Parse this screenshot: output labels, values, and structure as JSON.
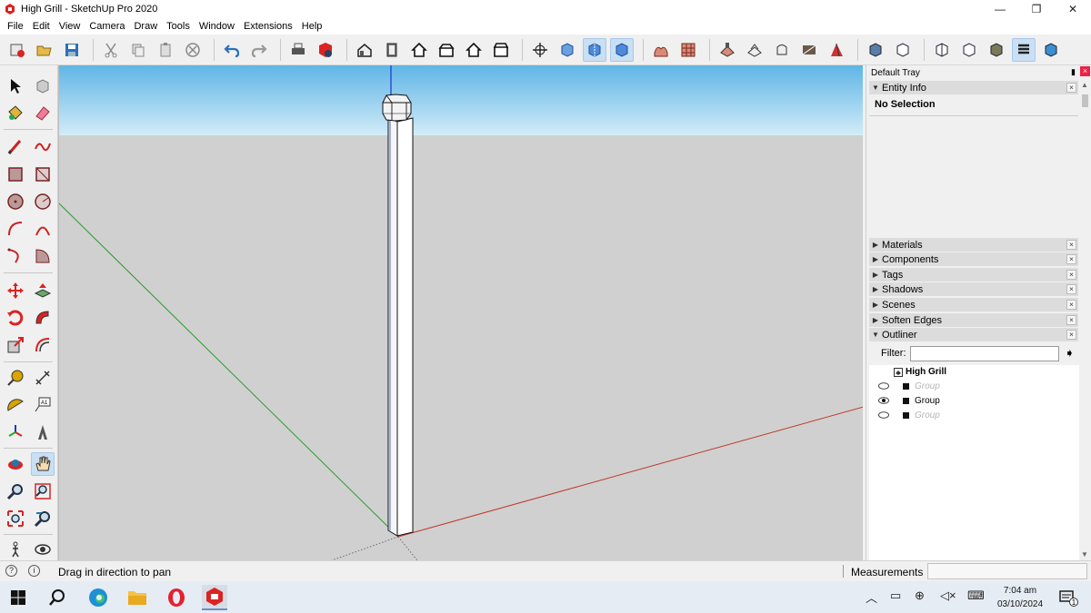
{
  "window": {
    "title": "High Grill - SketchUp Pro 2020",
    "minimize": "—",
    "restore": "❐",
    "close": "✕"
  },
  "menu": [
    "File",
    "Edit",
    "View",
    "Camera",
    "Draw",
    "Tools",
    "Window",
    "Extensions",
    "Help"
  ],
  "tray": {
    "title": "Default Tray",
    "pin": "▮",
    "close": "×",
    "entity_info": {
      "label": "Entity Info",
      "status": "No Selection"
    },
    "panels": [
      "Materials",
      "Components",
      "Tags",
      "Shadows",
      "Scenes",
      "Soften Edges",
      "Outliner"
    ],
    "panel_close": "×",
    "outliner": {
      "filter_label": "Filter:",
      "filter_value": "",
      "model_name": "High Grill",
      "rows": [
        {
          "label": "Group",
          "visible": false
        },
        {
          "label": "Group",
          "visible": true
        },
        {
          "label": "Group",
          "visible": false
        }
      ]
    }
  },
  "status": {
    "hint": "Drag in direction to pan",
    "measurements_label": "Measurements",
    "measurements_value": ""
  },
  "taskbar": {
    "time": "7:04 am",
    "date": "03/10/2024",
    "notification_count": "1"
  },
  "colors": {
    "sky_top": "#5fb5e6",
    "sky_bottom": "#cfe9f7",
    "ground": "#d2d2d2",
    "axis_red": "#c0392b",
    "axis_green": "#2e9a2e",
    "axis_blue": "#1f3fd0",
    "active_tool": "#c9dff3"
  },
  "icons": {
    "top_toolbar": [
      "component-icon",
      "open-icon",
      "save-icon",
      "cut-icon",
      "copy-icon",
      "paste-icon",
      "erase-icon",
      "undo-icon",
      "redo-icon",
      "print-icon",
      "model-info-icon",
      "iso-view-icon",
      "top-view-icon",
      "front-view-icon",
      "right-view-icon",
      "back-view-icon",
      "left-view-icon",
      "orbit-icon",
      "xray-icon",
      "back-edges-icon",
      "wireframe-icon",
      "hidden-line-icon",
      "shaded-icon",
      "textured-icon",
      "monochrome-icon",
      "sandbox-icon",
      "smoove-icon",
      "stamp-icon",
      "drape-icon",
      "add-detail-icon",
      "flip-edge-icon",
      "section-plane-icon",
      "section-display-icon",
      "section-cut-icon",
      "section-fill-icon",
      "warehouse-icon",
      "extension-warehouse-icon",
      "layout-icon"
    ],
    "left_toolbar": [
      "select-icon",
      "make-component-icon",
      "paint-bucket-icon",
      "eraser-icon",
      "line-icon",
      "freehand-icon",
      "rectangle-icon",
      "rotated-rectangle-icon",
      "circle-icon",
      "polygon-icon",
      "arc-icon",
      "two-point-arc-icon",
      "three-point-arc-icon",
      "pie-icon",
      "move-icon",
      "push-pull-icon",
      "rotate-icon",
      "follow-me-icon",
      "scale-icon",
      "offset-icon",
      "tape-measure-icon",
      "dimension-icon",
      "protractor-icon",
      "text-icon",
      "axes-icon",
      "3d-text-icon",
      "orbit-icon",
      "pan-icon",
      "zoom-icon",
      "zoom-window-icon",
      "zoom-extents-icon",
      "previous-view-icon",
      "walk-icon",
      "look-around-icon"
    ]
  }
}
